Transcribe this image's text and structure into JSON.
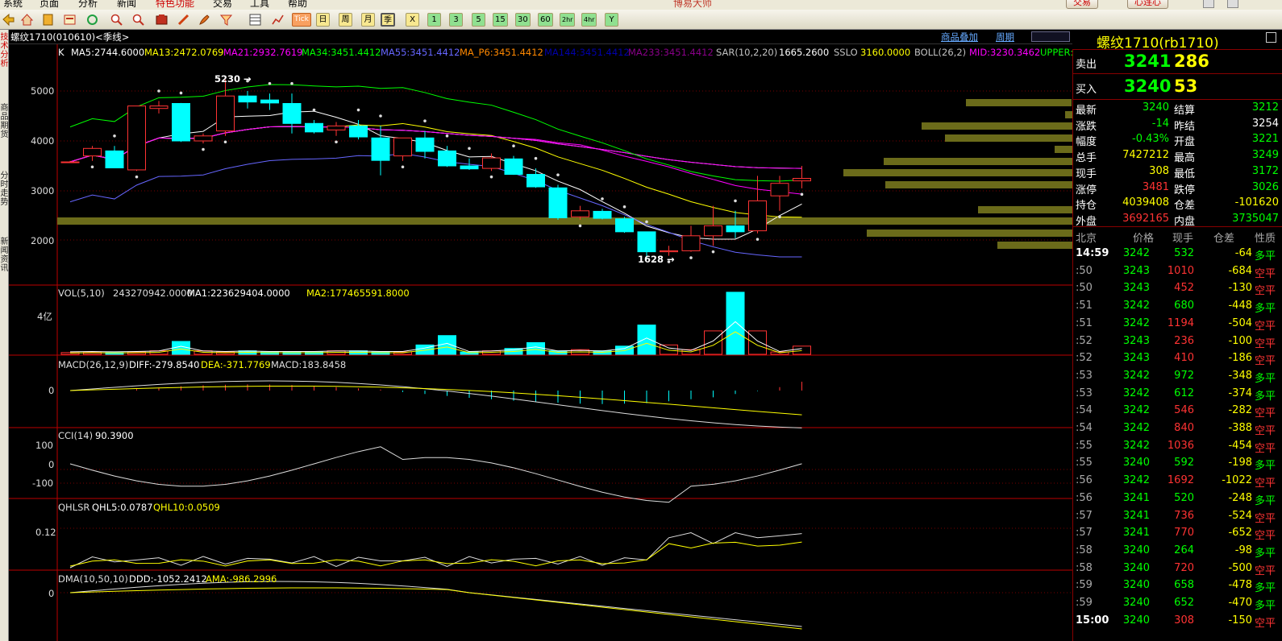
{
  "menu": {
    "items": [
      "系统",
      "页面",
      "分析",
      "新闻",
      "特色功能",
      "交易",
      "工具",
      "帮助"
    ],
    "active_item": "特色功能",
    "brand": "博易大师",
    "trade_button": "交易",
    "cloud_button": "心连心"
  },
  "toolbar": {
    "tick_button": "Tick",
    "periods": [
      "日",
      "周",
      "月",
      "季",
      "X",
      "1",
      "3",
      "5",
      "15",
      "30",
      "60",
      "2hr",
      "4hr",
      "Y"
    ],
    "active_period": "季"
  },
  "left_tabs": [
    "技术分析",
    "商品期货",
    "分时走势",
    "新闻资讯"
  ],
  "chart_header": {
    "title": "螺纹1710(010610)<季线>",
    "overlay_link": "商品叠加",
    "period_link": "周期"
  },
  "indicator_line": [
    {
      "text": "K",
      "color": "#ffffff"
    },
    {
      "text": "MA5:2744.6000",
      "color": "#ffffff"
    },
    {
      "text": "MA13:2472.0769",
      "color": "#ffff00"
    },
    {
      "text": "MA21:2932.7619",
      "color": "#ff00ff"
    },
    {
      "text": "MA34:3451.4412",
      "color": "#00ff00"
    },
    {
      "text": "MA55:3451.4412",
      "color": "#6666ff"
    },
    {
      "text": "MA_P6:3451.4412",
      "color": "#ff8800"
    },
    {
      "text": "MA144:3451.4412",
      "color": "#0000aa"
    },
    {
      "text": "MA233:3451.4412",
      "color": "#880088"
    },
    {
      "text": "SAR(10,2,20)",
      "color": "#c0c0c0"
    },
    {
      "text": "1665.2600",
      "color": "#ffffff"
    },
    {
      "text": "SSLO",
      "color": "#c0c0c0"
    },
    {
      "text": "3160.0000",
      "color": "#ffff00"
    },
    {
      "text": "BOLL(26,2)",
      "color": "#c0c0c0"
    },
    {
      "text": "MID:3230.3462",
      "color": "#ff00ff"
    },
    {
      "text": "UPPER:",
      "color": "#00ff00"
    }
  ],
  "price_axis": {
    "labels": [
      "5000",
      "4000",
      "3000",
      "2000"
    ],
    "high_marker": "5230",
    "low_marker": "1628"
  },
  "vol_panel": {
    "title": "VOL(5,10)",
    "vol": "243270942.0000",
    "ma1": "MA1:223629404.0000",
    "ma2": "MA2:177465591.8000",
    "axis_label": "4亿"
  },
  "macd_panel": {
    "title": "MACD(26,12,9)",
    "diff": "DIFF:-279.8540",
    "dea": "DEA:-371.7769",
    "macd": "MACD:183.8458",
    "axis_label": "0"
  },
  "cci_panel": {
    "title": "CCI(14)",
    "value": "90.3900",
    "axis_labels": [
      "100",
      "0",
      "-100"
    ]
  },
  "qhlsr_panel": {
    "title": "QHLSR",
    "qhl5": "QHL5:0.0787",
    "qhl10": "QHL10:0.0509",
    "axis_label": "0.12"
  },
  "dma_panel": {
    "title": "DMA(10,50,10)",
    "ddd": "DDD:-1052.2412",
    "ama": "AMA:-986.2996",
    "axis_label": "0"
  },
  "quote": {
    "name": "螺纹1710(rb1710)",
    "sell_label": "卖出",
    "sell_price": "3241",
    "sell_vol": "286",
    "buy_label": "买入",
    "buy_price": "3240",
    "buy_vol": "53",
    "stats": [
      {
        "l": "最新",
        "v": "3240",
        "vc": "#00ff00",
        "l2": "结算",
        "v2": "3212",
        "vc2": "#00ff00"
      },
      {
        "l": "涨跌",
        "v": "-14",
        "vc": "#00ff00",
        "l2": "昨结",
        "v2": "3254",
        "vc2": "#ffffff"
      },
      {
        "l": "幅度",
        "v": "-0.43%",
        "vc": "#00ff00",
        "l2": "开盘",
        "v2": "3221",
        "vc2": "#00ff00"
      },
      {
        "l": "总手",
        "v": "7427212",
        "vc": "#ffff00",
        "l2": "最高",
        "v2": "3249",
        "vc2": "#00ff00"
      },
      {
        "l": "现手",
        "v": "308",
        "vc": "#ffff00",
        "l2": "最低",
        "v2": "3172",
        "vc2": "#00ff00"
      },
      {
        "l": "涨停",
        "v": "3481",
        "vc": "#ff3333",
        "l2": "跌停",
        "v2": "3026",
        "vc2": "#00ff00"
      },
      {
        "l": "持仓",
        "v": "4039408",
        "vc": "#ffff00",
        "l2": "仓差",
        "v2": "-101620",
        "vc2": "#ffff00"
      },
      {
        "l": "外盘",
        "v": "3692165",
        "vc": "#ff3333",
        "l2": "内盘",
        "v2": "3735047",
        "vc2": "#00ff00"
      }
    ],
    "ticks_header": [
      "北京",
      "价格",
      "现手",
      "仓差",
      "性质"
    ],
    "ticks": [
      {
        "t": "14:59",
        "p": "3242",
        "v": "532",
        "d": "-64",
        "n": "多平"
      },
      {
        "t": ":50",
        "p": "3243",
        "v": "1010",
        "d": "-684",
        "n": "空平"
      },
      {
        "t": ":50",
        "p": "3243",
        "v": "452",
        "d": "-130",
        "n": "空平"
      },
      {
        "t": ":51",
        "p": "3242",
        "v": "680",
        "d": "-448",
        "n": "多平"
      },
      {
        "t": ":51",
        "p": "3242",
        "v": "1194",
        "d": "-504",
        "n": "空平"
      },
      {
        "t": ":52",
        "p": "3243",
        "v": "236",
        "d": "-100",
        "n": "空平"
      },
      {
        "t": ":52",
        "p": "3243",
        "v": "410",
        "d": "-186",
        "n": "空平"
      },
      {
        "t": ":53",
        "p": "3242",
        "v": "972",
        "d": "-348",
        "n": "多平"
      },
      {
        "t": ":53",
        "p": "3242",
        "v": "612",
        "d": "-374",
        "n": "多平"
      },
      {
        "t": ":54",
        "p": "3242",
        "v": "546",
        "d": "-282",
        "n": "空平"
      },
      {
        "t": ":54",
        "p": "3242",
        "v": "840",
        "d": "-388",
        "n": "空平"
      },
      {
        "t": ":55",
        "p": "3242",
        "v": "1036",
        "d": "-454",
        "n": "空平"
      },
      {
        "t": ":55",
        "p": "3240",
        "v": "592",
        "d": "-198",
        "n": "多平"
      },
      {
        "t": ":56",
        "p": "3242",
        "v": "1692",
        "d": "-1022",
        "n": "空平"
      },
      {
        "t": ":56",
        "p": "3241",
        "v": "520",
        "d": "-248",
        "n": "多平"
      },
      {
        "t": ":57",
        "p": "3241",
        "v": "736",
        "d": "-524",
        "n": "空平"
      },
      {
        "t": ":57",
        "p": "3241",
        "v": "770",
        "d": "-652",
        "n": "空平"
      },
      {
        "t": ":58",
        "p": "3240",
        "v": "264",
        "d": "-98",
        "n": "多平"
      },
      {
        "t": ":58",
        "p": "3240",
        "v": "720",
        "d": "-500",
        "n": "空平"
      },
      {
        "t": ":59",
        "p": "3240",
        "v": "658",
        "d": "-478",
        "n": "多平"
      },
      {
        "t": ":59",
        "p": "3240",
        "v": "652",
        "d": "-470",
        "n": "多平"
      },
      {
        "t": "15:00",
        "p": "3240",
        "v": "308",
        "d": "-150",
        "n": "空平"
      }
    ]
  },
  "chart_data": {
    "type": "candlestick",
    "note_period": "季线",
    "price_ylim": [
      1300,
      5600
    ],
    "candles": [
      {
        "o": 3580,
        "h": 3600,
        "l": 3560,
        "c": 3580
      },
      {
        "o": 3700,
        "h": 3900,
        "l": 3600,
        "c": 3850
      },
      {
        "o": 3800,
        "h": 3900,
        "l": 3460,
        "c": 3460
      },
      {
        "o": 3420,
        "h": 4580,
        "l": 3400,
        "c": 4700
      },
      {
        "o": 4650,
        "h": 4800,
        "l": 4550,
        "c": 4700
      },
      {
        "o": 4750,
        "h": 4760,
        "l": 3980,
        "c": 4000
      },
      {
        "o": 4000,
        "h": 4150,
        "l": 3950,
        "c": 4100
      },
      {
        "o": 4200,
        "h": 5230,
        "l": 4100,
        "c": 4900
      },
      {
        "o": 4900,
        "h": 5000,
        "l": 4650,
        "c": 4780
      },
      {
        "o": 4820,
        "h": 4950,
        "l": 4620,
        "c": 4760
      },
      {
        "o": 4750,
        "h": 4950,
        "l": 4150,
        "c": 4350
      },
      {
        "o": 4350,
        "h": 4420,
        "l": 4150,
        "c": 4180
      },
      {
        "o": 4220,
        "h": 4380,
        "l": 4100,
        "c": 4300
      },
      {
        "o": 4300,
        "h": 4420,
        "l": 4030,
        "c": 4080
      },
      {
        "o": 4060,
        "h": 4300,
        "l": 3310,
        "c": 3610
      },
      {
        "o": 3700,
        "h": 4000,
        "l": 3600,
        "c": 4060
      },
      {
        "o": 4060,
        "h": 4200,
        "l": 3650,
        "c": 3790
      },
      {
        "o": 3800,
        "h": 3900,
        "l": 3480,
        "c": 3500
      },
      {
        "o": 3500,
        "h": 3650,
        "l": 3420,
        "c": 3440
      },
      {
        "o": 3450,
        "h": 3750,
        "l": 3400,
        "c": 3660
      },
      {
        "o": 3640,
        "h": 3700,
        "l": 3320,
        "c": 3330
      },
      {
        "o": 3330,
        "h": 3450,
        "l": 3060,
        "c": 3080
      },
      {
        "o": 3060,
        "h": 3120,
        "l": 2420,
        "c": 2460
      },
      {
        "o": 2480,
        "h": 2700,
        "l": 2420,
        "c": 2600
      },
      {
        "o": 2590,
        "h": 2640,
        "l": 2430,
        "c": 2450
      },
      {
        "o": 2440,
        "h": 2480,
        "l": 2160,
        "c": 2180
      },
      {
        "o": 2180,
        "h": 2180,
        "l": 1628,
        "c": 1780
      },
      {
        "o": 1780,
        "h": 1900,
        "l": 1700,
        "c": 1800
      },
      {
        "o": 1800,
        "h": 2300,
        "l": 1780,
        "c": 2100
      },
      {
        "o": 2100,
        "h": 2700,
        "l": 1900,
        "c": 2300
      },
      {
        "o": 2300,
        "h": 2600,
        "l": 2050,
        "c": 2180
      },
      {
        "o": 2200,
        "h": 3300,
        "l": 2150,
        "c": 2800
      },
      {
        "o": 2900,
        "h": 3300,
        "l": 2600,
        "c": 3150
      },
      {
        "o": 3200,
        "h": 3500,
        "l": 3050,
        "c": 3250
      }
    ],
    "volume_ylim": [
      0,
      550000000
    ],
    "volume": [
      15000000,
      20000000,
      15000000,
      20000000,
      30000000,
      110000000,
      30000000,
      20000000,
      30000000,
      20000000,
      20000000,
      20000000,
      30000000,
      30000000,
      20000000,
      20000000,
      80000000,
      160000000,
      20000000,
      30000000,
      50000000,
      100000000,
      30000000,
      40000000,
      30000000,
      70000000,
      250000000,
      80000000,
      40000000,
      200000000,
      530000000,
      200000000,
      20000000,
      70000000,
      200000000
    ],
    "macd_bars": [
      0,
      0,
      0,
      30,
      60,
      90,
      110,
      120,
      130,
      125,
      115,
      95,
      70,
      45,
      20,
      -30,
      -70,
      -110,
      -150,
      -180,
      -210,
      -230,
      -250,
      -270,
      -280,
      -270,
      -260,
      -220,
      -180,
      -140,
      -70,
      -10,
      70,
      184
    ]
  }
}
